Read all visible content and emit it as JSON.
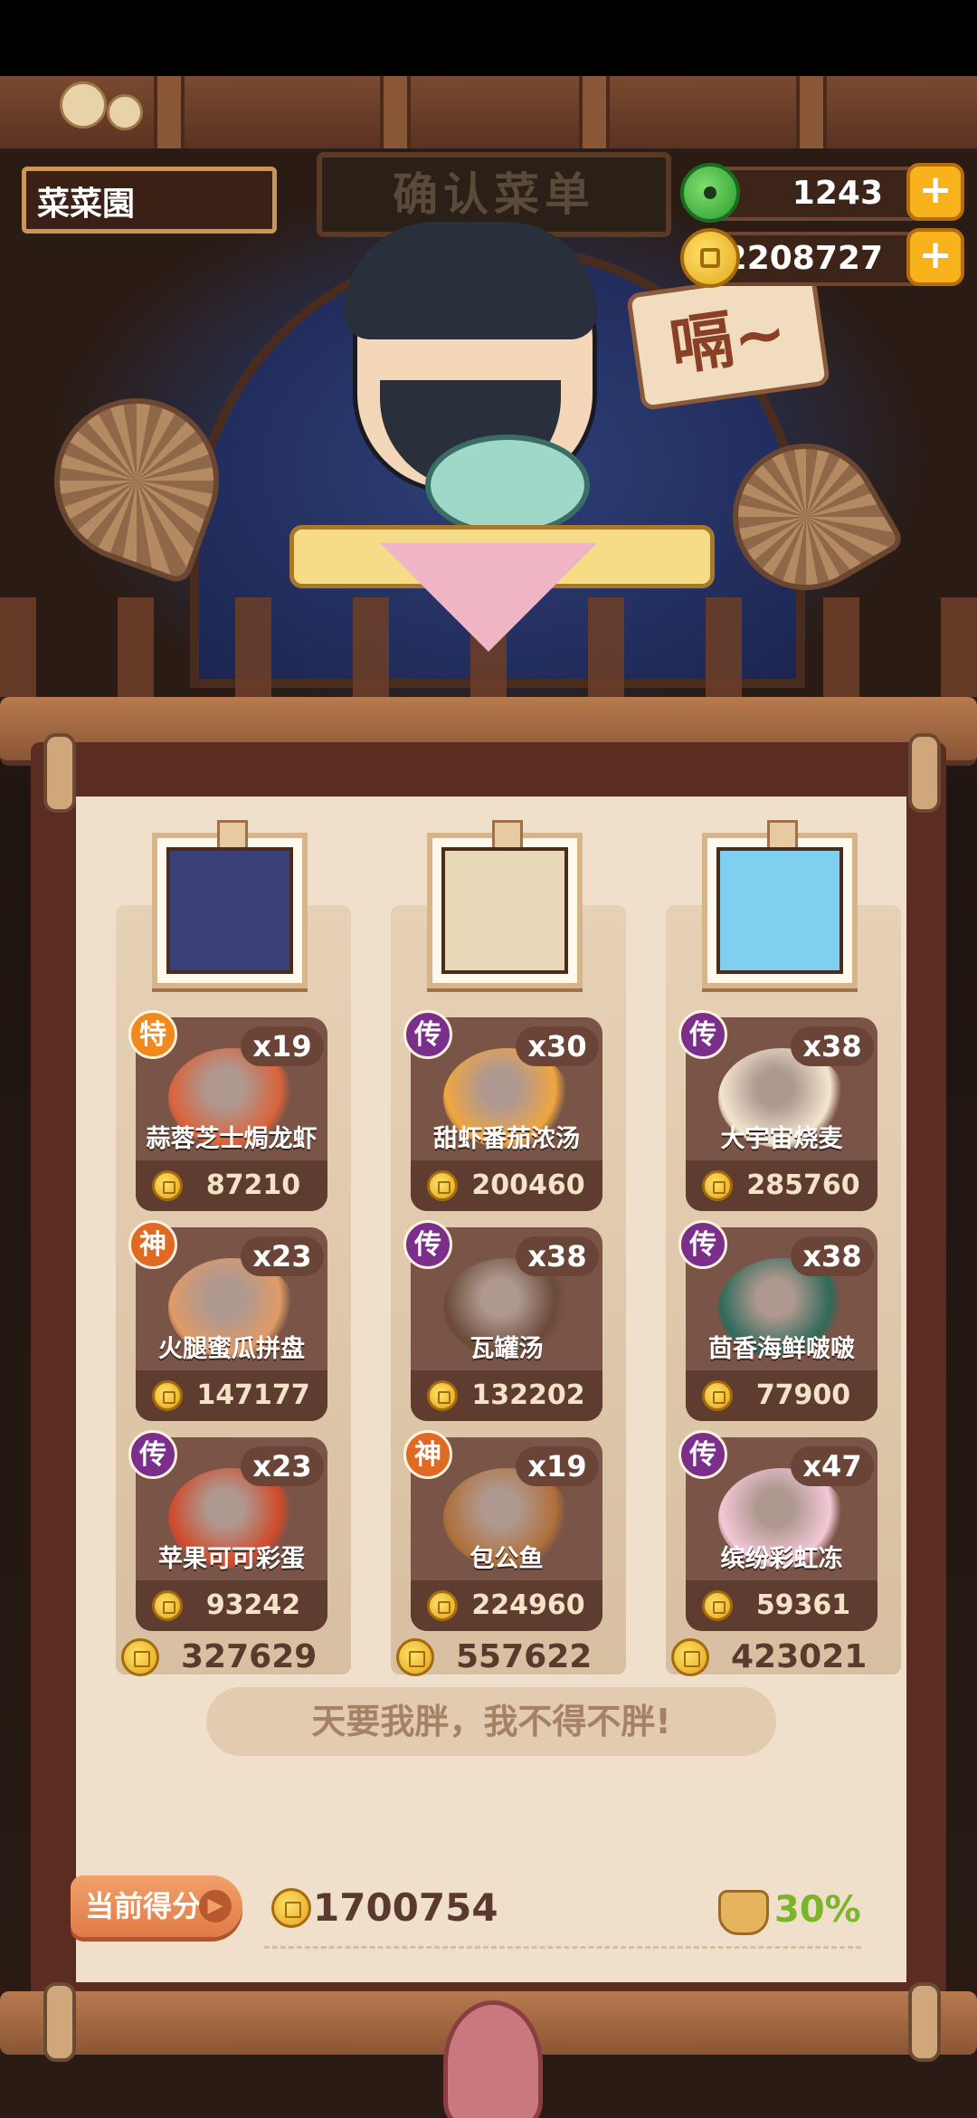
{
  "header": {
    "restaurant_name": "菜菜園",
    "sign_text": "确认菜单",
    "jade_amount": "1243",
    "coin_amount": "2208727",
    "plus_label": "+",
    "speech_text": "嗝~"
  },
  "columns": [
    {
      "total": "327629",
      "dishes": [
        {
          "badge": "特",
          "badge_color": "#f08a1c",
          "qty": "x19",
          "name": "蒜蓉芝士焗龙虾",
          "price": "87210",
          "dish_color": "#d9633a"
        },
        {
          "badge": "神",
          "badge_color": "#e06a24",
          "qty": "x23",
          "name": "火腿蜜瓜拼盘",
          "price": "147177",
          "dish_color": "#e09a66"
        },
        {
          "badge": "传",
          "badge_color": "#7b2f8a",
          "qty": "x23",
          "name": "苹果可可彩蛋",
          "price": "93242",
          "dish_color": "#d04a2a"
        }
      ]
    },
    {
      "total": "557622",
      "dishes": [
        {
          "badge": "传",
          "badge_color": "#7b2f8a",
          "qty": "x30",
          "name": "甜虾番茄浓汤",
          "price": "200460",
          "dish_color": "#f0a640"
        },
        {
          "badge": "传",
          "badge_color": "#7b2f8a",
          "qty": "x38",
          "name": "瓦罐汤",
          "price": "132202",
          "dish_color": "#6a4a38"
        },
        {
          "badge": "神",
          "badge_color": "#e06a24",
          "qty": "x19",
          "name": "包公鱼",
          "price": "224960",
          "dish_color": "#b0703a"
        }
      ]
    },
    {
      "total": "423021",
      "dishes": [
        {
          "badge": "传",
          "badge_color": "#7b2f8a",
          "qty": "x38",
          "name": "大宇宙烧麦",
          "price": "285760",
          "dish_color": "#f3e6cf"
        },
        {
          "badge": "传",
          "badge_color": "#7b2f8a",
          "qty": "x38",
          "name": "茴香海鲜啵啵",
          "price": "77900",
          "dish_color": "#2e6a5a"
        },
        {
          "badge": "传",
          "badge_color": "#7b2f8a",
          "qty": "x47",
          "name": "缤纷彩虹冻",
          "price": "59361",
          "dish_color": "#f4c8d8"
        }
      ]
    }
  ],
  "portraits": [
    {
      "icon": "purple-hair-girl-portrait",
      "color": "#3a3f7a"
    },
    {
      "icon": "white-hair-man-portrait",
      "color": "#e8d8b8"
    },
    {
      "icon": "blue-hair-girl-portrait",
      "color": "#7fd0f0"
    }
  ],
  "quote": "天要我胖，我不得不胖!",
  "score": {
    "label": "当前得分",
    "arrow": "▶",
    "total": "1700754",
    "bonus": "30%"
  }
}
